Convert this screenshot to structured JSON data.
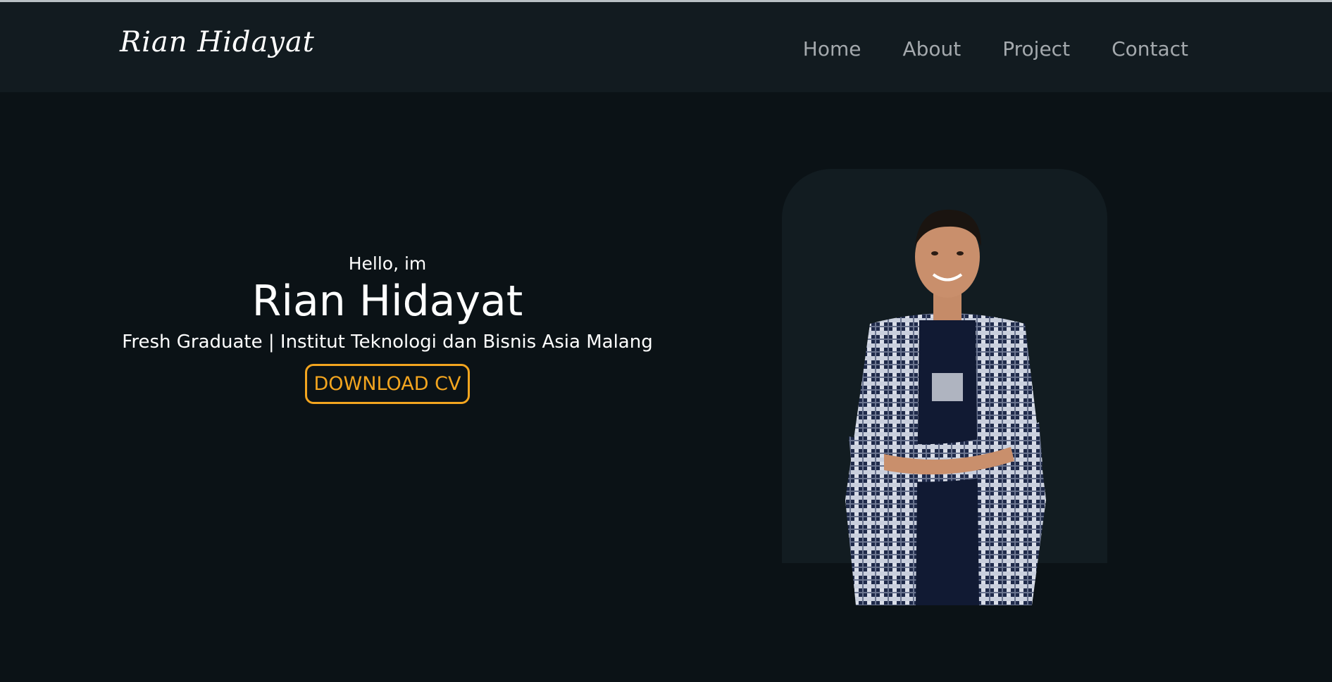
{
  "header": {
    "logo": "Rian Hidayat",
    "nav": [
      "Home",
      "About",
      "Project",
      "Contact"
    ]
  },
  "hero": {
    "greeting": "Hello, im",
    "name": "Rian Hidayat",
    "subtitle": "Fresh Graduate | Institut Teknologi dan Bisnis Asia Malang",
    "button": "DOWNLOAD CV"
  },
  "colors": {
    "background": "#0b1216",
    "navbar": "#121b20",
    "accent": "#f3a51f",
    "nav_text": "#a4a9ad"
  }
}
